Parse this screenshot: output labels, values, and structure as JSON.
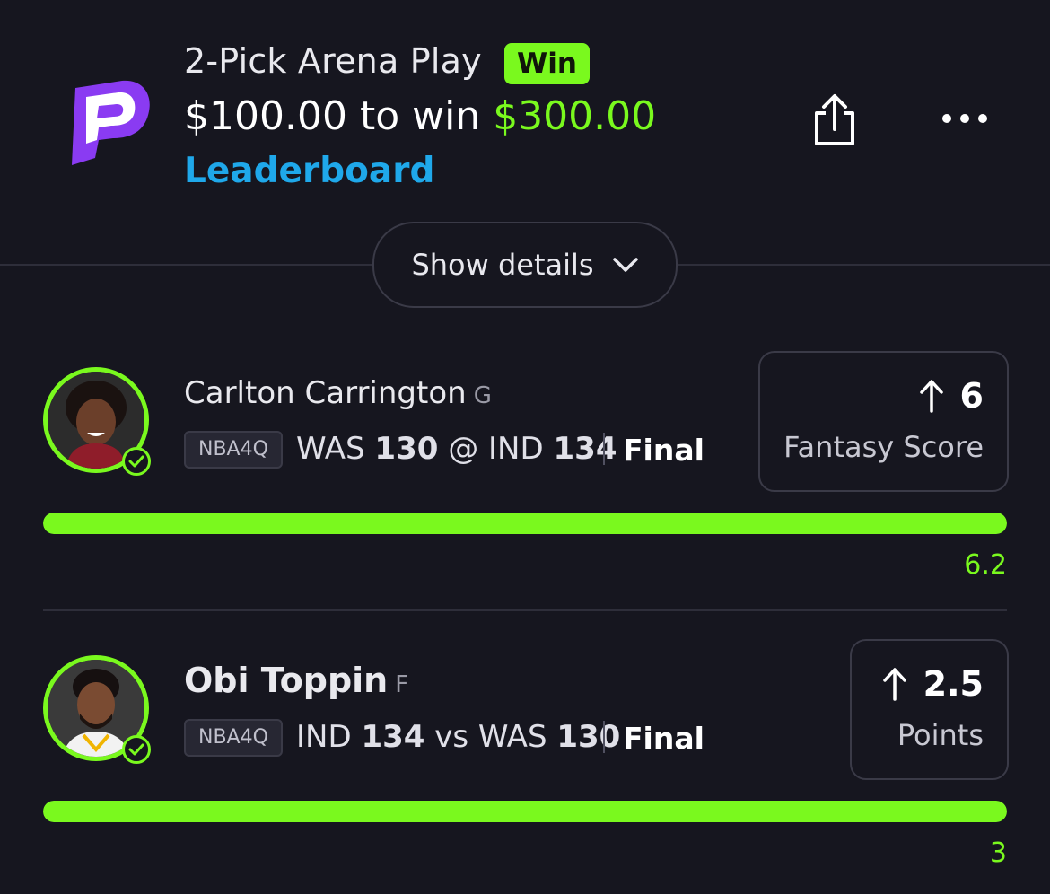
{
  "header": {
    "title": "2-Pick Arena Play",
    "badge": "Win",
    "wager_prefix": "$100.00 to win ",
    "payout": "$300.00",
    "leaderboard": "Leaderboard",
    "show_details": "Show details"
  },
  "colors": {
    "accent": "#7af91e",
    "link": "#1fa8ea",
    "brand": "#8a3bf2",
    "background": "#16161f"
  },
  "picks": [
    {
      "name": "Carlton Carrington",
      "position": "G",
      "league_tag": "NBA4Q",
      "team_a": "WAS",
      "score_a": "130",
      "separator": "@",
      "team_b": "IND",
      "score_b": "134",
      "status": "Final",
      "projection": "6",
      "stat": "Fantasy Score",
      "result": "6.2",
      "progress": 1.0
    },
    {
      "name": "Obi Toppin",
      "position": "F",
      "league_tag": "NBA4Q",
      "team_a": "IND",
      "score_a": "134",
      "separator": "vs",
      "team_b": "WAS",
      "score_b": "130",
      "status": "Final",
      "projection": "2.5",
      "stat": "Points",
      "result": "3",
      "progress": 1.0
    }
  ]
}
